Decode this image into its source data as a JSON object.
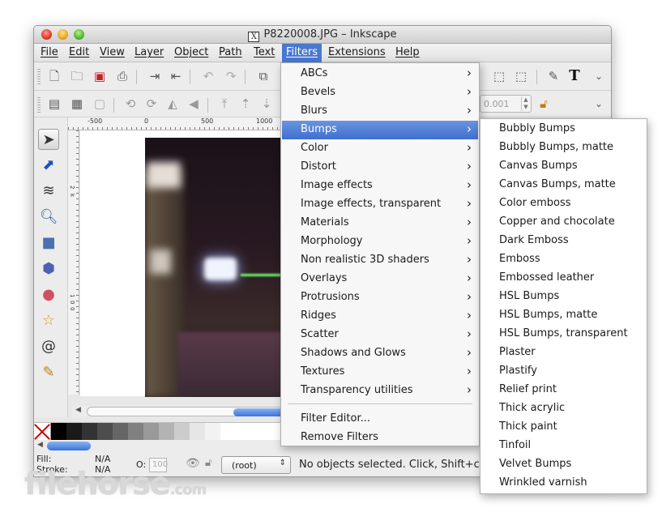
{
  "window": {
    "title": "P8220008.JPG – Inkscape",
    "app_icon": "x11-icon"
  },
  "menubar": [
    {
      "label": "File",
      "active": false
    },
    {
      "label": "Edit",
      "active": false
    },
    {
      "label": "View",
      "active": false
    },
    {
      "label": "Layer",
      "active": false
    },
    {
      "label": "Object",
      "active": false
    },
    {
      "label": "Path",
      "active": false
    },
    {
      "label": "Text",
      "active": false
    },
    {
      "label": "Filters",
      "active": true
    },
    {
      "label": "Extensions",
      "active": false
    },
    {
      "label": "Help",
      "active": false
    }
  ],
  "toolbar2": {
    "spin_value": "0.001"
  },
  "ruler": {
    "h_ticks": [
      "-500",
      "0",
      "500",
      "1000"
    ],
    "v_ticks": [
      "2",
      "k",
      "1",
      "0",
      "0"
    ]
  },
  "filters_menu": {
    "items": [
      {
        "label": "ABCs",
        "submenu": true
      },
      {
        "label": "Bevels",
        "submenu": true
      },
      {
        "label": "Blurs",
        "submenu": true
      },
      {
        "label": "Bumps",
        "submenu": true,
        "highlighted": true
      },
      {
        "label": "Color",
        "submenu": true
      },
      {
        "label": "Distort",
        "submenu": true
      },
      {
        "label": "Image effects",
        "submenu": true
      },
      {
        "label": "Image effects, transparent",
        "submenu": true
      },
      {
        "label": "Materials",
        "submenu": true
      },
      {
        "label": "Morphology",
        "submenu": true
      },
      {
        "label": "Non realistic 3D shaders",
        "submenu": true
      },
      {
        "label": "Overlays",
        "submenu": true
      },
      {
        "label": "Protrusions",
        "submenu": true
      },
      {
        "label": "Ridges",
        "submenu": true
      },
      {
        "label": "Scatter",
        "submenu": true
      },
      {
        "label": "Shadows and Glows",
        "submenu": true
      },
      {
        "label": "Textures",
        "submenu": true
      },
      {
        "label": "Transparency utilities",
        "submenu": true
      }
    ],
    "extra": [
      {
        "label": "Filter Editor..."
      },
      {
        "label": "Remove Filters"
      }
    ]
  },
  "bumps_submenu": [
    "Bubbly Bumps",
    "Bubbly Bumps, matte",
    "Canvas Bumps",
    "Canvas Bumps, matte",
    "Color emboss",
    "Copper and chocolate",
    "Dark Emboss",
    "Emboss",
    "Embossed leather",
    "HSL Bumps",
    "HSL Bumps, matte",
    "HSL Bumps, transparent",
    "Plaster",
    "Plastify",
    "Relief print",
    "Thick acrylic",
    "Thick paint",
    "Tinfoil",
    "Velvet Bumps",
    "Wrinkled varnish"
  ],
  "palette": [
    "#000000",
    "#1a1a1a",
    "#333333",
    "#4d4d4d",
    "#666666",
    "#808080",
    "#999999",
    "#b3b3b3",
    "#cccccc",
    "#e6e6e6",
    "#f2f2f2",
    "#ffffff",
    "#ffffff",
    "#ffffff",
    "#ffffff",
    "#800000"
  ],
  "status": {
    "fill_label": "Fill:",
    "fill_value": "N/A",
    "stroke_label": "Stroke:",
    "stroke_value": "N/A",
    "opacity_label": "O:",
    "opacity_value": "100",
    "layer": "(root)",
    "message": "No objects selected. Click, Shift+c"
  },
  "watermark": {
    "main": "filehorse",
    "suffix": ".com"
  }
}
